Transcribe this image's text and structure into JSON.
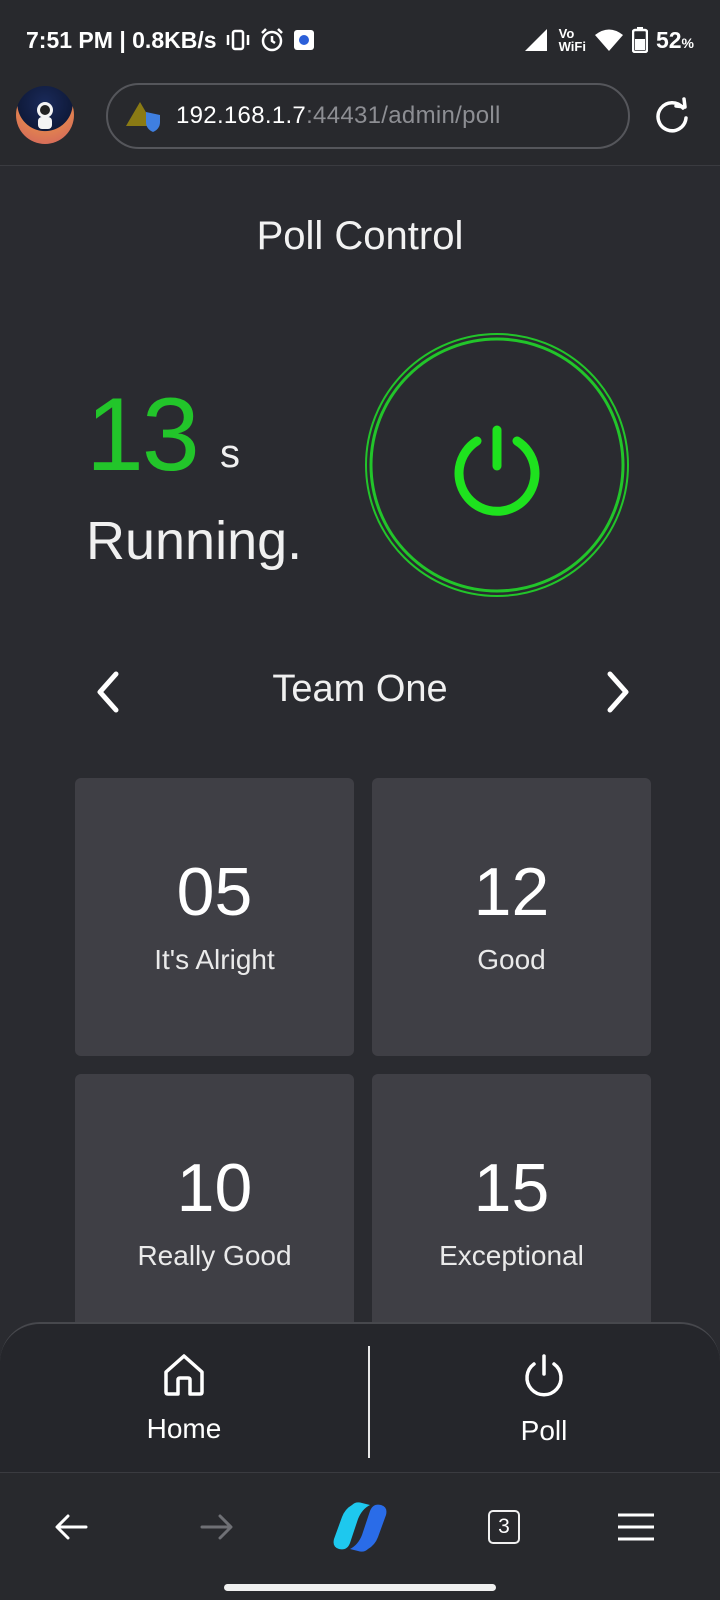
{
  "status_bar": {
    "time_speed": "7:51 PM | 0.8KB/s",
    "vowifi_top": "Vo",
    "vowifi_bottom": "WiFi",
    "battery_value": "52",
    "battery_unit": "%"
  },
  "browser": {
    "url_host": "192.168.1.7",
    "url_path": ":44431/admin/poll",
    "tab_count": "3"
  },
  "page": {
    "title": "Poll Control",
    "timer_value": "13",
    "timer_unit": "s",
    "status": "Running.",
    "team_name": "Team One"
  },
  "results": [
    {
      "value": "05",
      "label": "It's Alright"
    },
    {
      "value": "12",
      "label": "Good"
    },
    {
      "value": "10",
      "label": "Really Good"
    },
    {
      "value": "15",
      "label": "Exceptional"
    }
  ],
  "bottom_nav": {
    "home_label": "Home",
    "poll_label": "Poll"
  },
  "colors": {
    "accent_green": "#22c52a",
    "background": "#2a2b30",
    "card": "#3f3f45"
  },
  "icons": [
    "vibrate-icon",
    "alarm-icon",
    "app-notification-icon",
    "signal-icon",
    "wifi-icon",
    "battery-icon",
    "security-warning-icon",
    "reload-icon",
    "power-icon",
    "chevron-left-icon",
    "chevron-right-icon",
    "home-icon",
    "back-arrow-icon",
    "forward-arrow-icon",
    "copilot-icon",
    "menu-icon"
  ]
}
